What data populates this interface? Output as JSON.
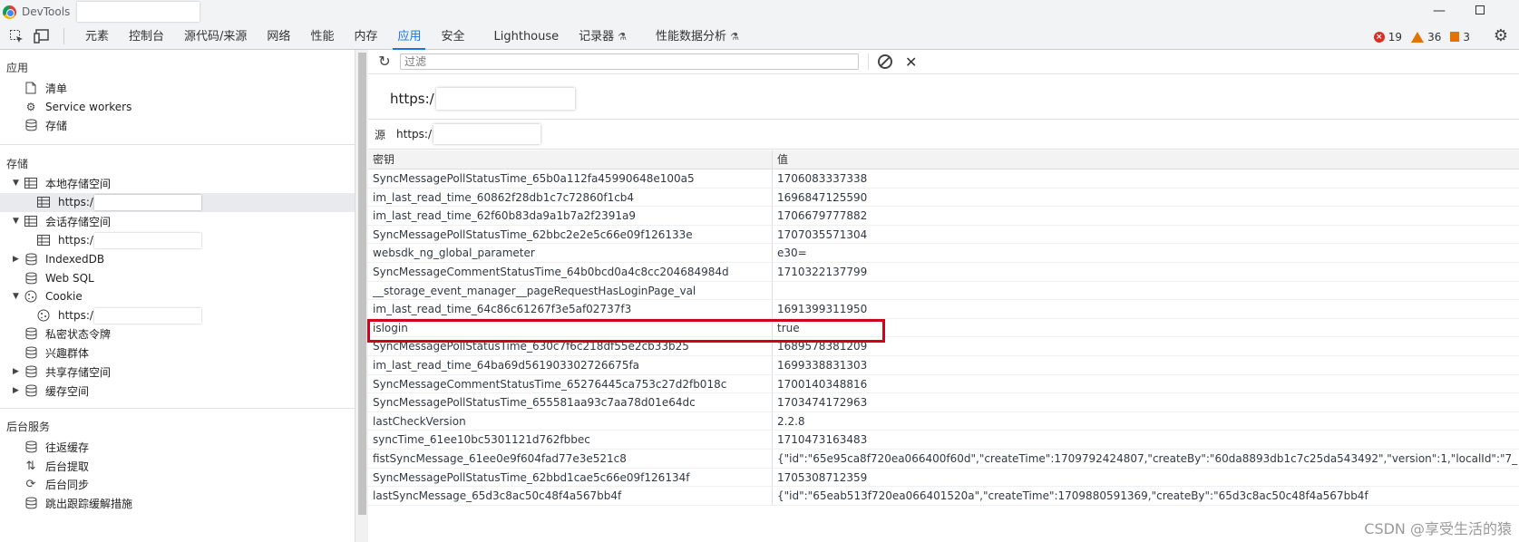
{
  "window": {
    "app_title": "DevTools"
  },
  "tabs": [
    {
      "label": "元素"
    },
    {
      "label": "控制台"
    },
    {
      "label": "源代码/来源"
    },
    {
      "label": "网络"
    },
    {
      "label": "性能"
    },
    {
      "label": "内存"
    },
    {
      "label": "应用"
    },
    {
      "label": "安全"
    },
    {
      "label": "Lighthouse"
    },
    {
      "label": "记录器"
    },
    {
      "label": "性能数据分析"
    }
  ],
  "status": {
    "errors": "19",
    "warnings": "36",
    "issues": "3"
  },
  "sidebar": {
    "section_app": "应用",
    "app_items": [
      {
        "label": "清单",
        "icon": "file-icon"
      },
      {
        "label": "Service workers",
        "icon": "gears-icon"
      },
      {
        "label": "存储",
        "icon": "database-icon"
      }
    ],
    "section_storage": "存储",
    "local_storage": "本地存储空间",
    "session_storage": "会话存储空间",
    "origin_prefix": "https:/",
    "indexeddb": "IndexedDB",
    "websql": "Web SQL",
    "cookie": "Cookie",
    "private_tokens": "私密状态令牌",
    "interest_groups": "兴趣群体",
    "shared_storage": "共享存储空间",
    "cache_storage": "缓存空间",
    "section_background": "后台服务",
    "background_items": [
      {
        "label": "往返缓存"
      },
      {
        "label": "后台提取"
      },
      {
        "label": "后台同步"
      },
      {
        "label": "跳出跟踪缓解措施"
      }
    ]
  },
  "toolbar": {
    "filter_placeholder": "过滤"
  },
  "origin": {
    "big_prefix": "https:/",
    "label": "源",
    "value_prefix": "https:/"
  },
  "table": {
    "headers": {
      "key": "密钥",
      "value": "值"
    },
    "rows": [
      {
        "key": "SyncMessagePollStatusTime_65b0a112fa45990648e100a5",
        "value": "1706083337338"
      },
      {
        "key": "im_last_read_time_60862f28db1c7c72860f1cb4",
        "value": "1696847125590"
      },
      {
        "key": "im_last_read_time_62f60b83da9a1b7a2f2391a9",
        "value": "1706679777882"
      },
      {
        "key": "SyncMessagePollStatusTime_62bbc2e2e5c66e09f126133e",
        "value": "1707035571304"
      },
      {
        "key": "websdk_ng_global_parameter",
        "value": "e30="
      },
      {
        "key": "SyncMessageCommentStatusTime_64b0bcd0a4c8cc204684984d",
        "value": "1710322137799"
      },
      {
        "key": "__storage_event_manager__pageRequestHasLoginPage_val",
        "value": ""
      },
      {
        "key": "im_last_read_time_64c86c61267f3e5af02737f3",
        "value": "1691399311950"
      },
      {
        "key": "islogin",
        "value": "true"
      },
      {
        "key": "SyncMessagePollStatusTime_630c7f6c218df55e2cb33b25",
        "value": "1689578381209"
      },
      {
        "key": "im_last_read_time_64ba69d561903302726675fa",
        "value": "1699338831303"
      },
      {
        "key": "SyncMessageCommentStatusTime_65276445ca753c27d2fb018c",
        "value": "1700140348816"
      },
      {
        "key": "SyncMessagePollStatusTime_655581aa93c7aa78d01e64dc",
        "value": "1703474172963"
      },
      {
        "key": "lastCheckVersion",
        "value": "2.2.8"
      },
      {
        "key": "syncTime_61ee10bc5301121d762fbbec",
        "value": "1710473163483"
      },
      {
        "key": "fistSyncMessage_61ee0e9f604fad77e3e521c8",
        "value": "{\"id\":\"65e95ca8f720ea066400f60d\",\"createTime\":1709792424807,\"createBy\":\"60da8893db1c7c25da543492\",\"version\":1,\"localId\":\"7_"
      },
      {
        "key": "SyncMessagePollStatusTime_62bbd1cae5c66e09f126134f",
        "value": "1705308712359"
      },
      {
        "key": "lastSyncMessage_65d3c8ac50c48f4a567bb4f",
        "value": "{\"id\":\"65eab513f720ea066401520a\",\"createTime\":1709880591369,\"createBy\":\"65d3c8ac50c48f4a567bb4f"
      }
    ]
  },
  "watermark": "CSDN @享受生活的猿"
}
